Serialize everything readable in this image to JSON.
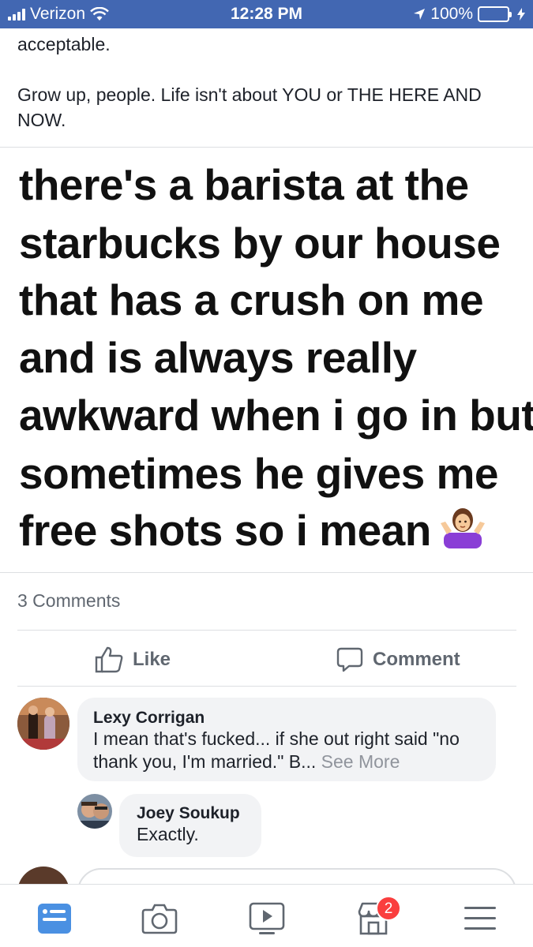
{
  "status_bar": {
    "carrier": "Verizon",
    "time": "12:28 PM",
    "battery": "100%"
  },
  "post": {
    "text_lines": [
      "acceptable.",
      "Grow up, people. Life isn't about YOU or THE HERE AND NOW."
    ]
  },
  "meme": {
    "lines": [
      "there's a barista at the",
      "starbucks by our house",
      "that has a crush on me",
      "and is always really",
      "awkward when i go in but",
      "sometimes he gives me",
      "free shots so i mean"
    ],
    "emoji": "person-shrugging-icon"
  },
  "comments_count": "3 Comments",
  "actions": {
    "like": "Like",
    "comment": "Comment"
  },
  "comments": [
    {
      "name": "Lexy Corrigan",
      "text": "I mean that's fucked... if she out right said \"no thank you, I'm married.\" B...",
      "see_more": "See More"
    },
    {
      "name": "Joey Soukup",
      "text": "Exactly."
    }
  ],
  "bottom_nav": {
    "items": [
      "news-feed-icon",
      "camera-icon",
      "watch-icon",
      "marketplace-icon",
      "menu-icon"
    ],
    "badge": "2"
  },
  "colors": {
    "brand": "#4267b2",
    "badge": "#fa3e3e",
    "active": "#4a90e2"
  }
}
